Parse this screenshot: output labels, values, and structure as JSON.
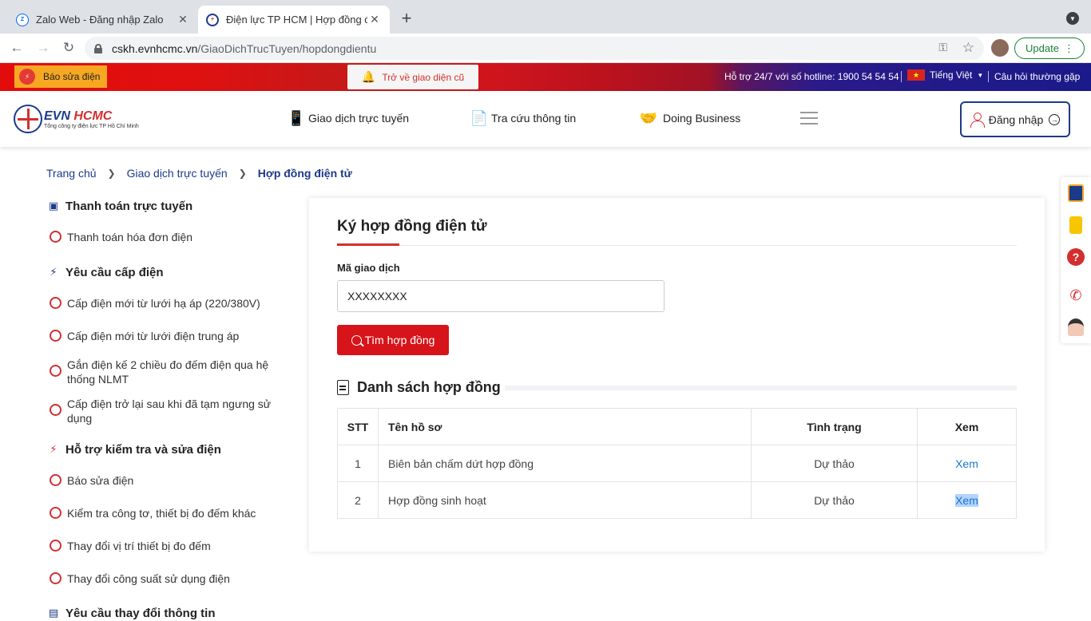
{
  "browser": {
    "tabs": [
      {
        "title": "Zalo Web - Đăng nhập Zalo",
        "favicon": "Zalo",
        "active": false
      },
      {
        "title": "Điện lực TP HCM | Hợp đồng điện tử",
        "favicon": "evn",
        "active": true
      }
    ],
    "url_host": "cskh.evnhcmc.vn",
    "url_path": "/GiaoDichTrucTuyen/hopdongdientu",
    "update_label": "Update"
  },
  "topbar": {
    "report_label": "Báo sửa điện",
    "old_ui_label": "Trở về giao diện cũ",
    "hotline": "Hỗ trợ 24/7 với số hotline: 1900 54 54 54",
    "language": "Tiếng Việt",
    "faq": "Câu hỏi thường gặp"
  },
  "header": {
    "logo_evn": "EVN",
    "logo_hcmc": "HCMC",
    "logo_sub": "Tổng công ty điện lực TP Hồ Chí Minh",
    "nav": [
      "Giao dịch trực tuyến",
      "Tra cứu thông tin",
      "Doing Business"
    ],
    "login_label": "Đăng nhập"
  },
  "breadcrumb": [
    "Trang chủ",
    "Giao dịch trực tuyến",
    "Hợp đồng điện tử"
  ],
  "sidebar": {
    "sections": [
      {
        "title": "Thanh toán trực tuyến",
        "items": [
          "Thanh toán hóa đơn điện"
        ]
      },
      {
        "title": "Yêu cầu cấp điện",
        "items": [
          "Cấp điện mới từ lưới hạ áp (220/380V)",
          "Cấp điện mới từ lưới điện trung áp",
          "Gắn điện kế 2 chiều đo đếm điện qua hệ thống NLMT",
          "Cấp điện trở lại sau khi đã tạm ngưng sử dụng"
        ]
      },
      {
        "title": "Hỗ trợ kiểm tra và sửa điện",
        "items": [
          "Báo sửa điện",
          "Kiểm tra công tơ, thiết bị đo đếm khác",
          "Thay đổi vị trí thiết bị đo đếm",
          "Thay đổi công suất sử dụng điện"
        ]
      },
      {
        "title": "Yêu cầu thay đổi thông tin",
        "items": []
      }
    ]
  },
  "main": {
    "title": "Ký hợp đồng điện tử",
    "field_label": "Mã giao dịch",
    "field_value": "XXXXXXXX",
    "search_button": "Tìm hợp đồng",
    "list_title": "Danh sách hợp đồng",
    "table": {
      "headers": [
        "STT",
        "Tên hồ sơ",
        "Tình trạng",
        "Xem"
      ],
      "rows": [
        [
          "1",
          "Biên bản chấm dứt hợp đồng",
          "Dự thảo",
          "Xem"
        ],
        [
          "2",
          "Hợp đồng sinh hoạt",
          "Dự thảo",
          "Xem"
        ]
      ]
    }
  },
  "colors": {
    "brand_red": "#d7141a",
    "brand_blue": "#1b3a8a"
  }
}
